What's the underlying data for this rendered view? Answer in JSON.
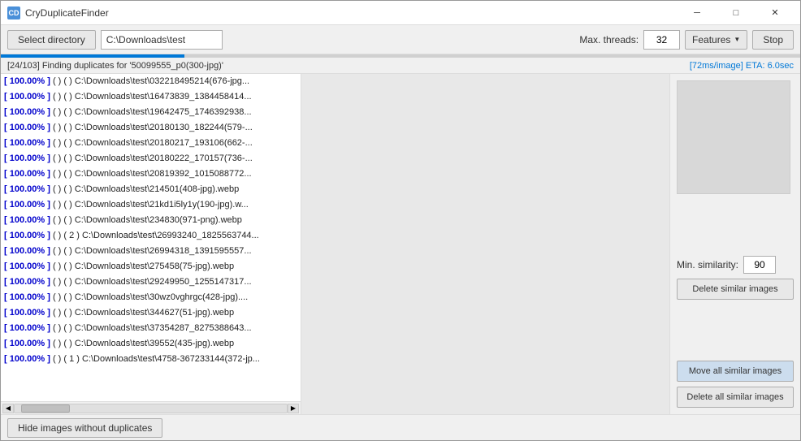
{
  "window": {
    "title": "CryDuplicateFinder",
    "icon": "CD"
  },
  "titleControls": {
    "minimize": "─",
    "maximize": "□",
    "close": "✕"
  },
  "toolbar": {
    "select_directory_label": "Select directory",
    "path_value": "C:\\Downloads\\test",
    "max_threads_label": "Max. threads:",
    "threads_value": "32",
    "features_label": "Features",
    "stop_label": "Stop"
  },
  "progress": {
    "fill_percent": 23,
    "status_text": "[24/103] Finding duplicates for '50099555_p0(300-jpg)'",
    "eta_text": "[72ms/image] ETA: 6.0sec"
  },
  "list": {
    "items": [
      {
        "pct": "[ 100.00% ]",
        "info": "( ) (  )",
        "path": "C:\\Downloads\\test\\032218495214(676-jpg..."
      },
      {
        "pct": "[ 100.00% ]",
        "info": "( ) (  )",
        "path": "C:\\Downloads\\test\\16473839_1384458414..."
      },
      {
        "pct": "[ 100.00% ]",
        "info": "( ) (  )",
        "path": "C:\\Downloads\\test\\19642475_1746392938..."
      },
      {
        "pct": "[ 100.00% ]",
        "info": "( ) (  )",
        "path": "C:\\Downloads\\test\\20180130_182244(579-..."
      },
      {
        "pct": "[ 100.00% ]",
        "info": "( ) (  )",
        "path": "C:\\Downloads\\test\\20180217_193106(662-..."
      },
      {
        "pct": "[ 100.00% ]",
        "info": "( ) (  )",
        "path": "C:\\Downloads\\test\\20180222_170157(736-..."
      },
      {
        "pct": "[ 100.00% ]",
        "info": "( ) (  )",
        "path": "C:\\Downloads\\test\\20819392_1015088772..."
      },
      {
        "pct": "[ 100.00% ]",
        "info": "( ) (  )",
        "path": "C:\\Downloads\\test\\214501(408-jpg).webp"
      },
      {
        "pct": "[ 100.00% ]",
        "info": "( ) (  )",
        "path": "C:\\Downloads\\test\\21kd1i5ly1y(190-jpg).w..."
      },
      {
        "pct": "[ 100.00% ]",
        "info": "( ) (  )",
        "path": "C:\\Downloads\\test\\234830(971-png).webp"
      },
      {
        "pct": "[ 100.00% ]",
        "info": "( ) ( 2 )",
        "path": "C:\\Downloads\\test\\26993240_1825563744..."
      },
      {
        "pct": "[ 100.00% ]",
        "info": "( ) (  )",
        "path": "C:\\Downloads\\test\\26994318_1391595557..."
      },
      {
        "pct": "[ 100.00% ]",
        "info": "( ) (  )",
        "path": "C:\\Downloads\\test\\275458(75-jpg).webp"
      },
      {
        "pct": "[ 100.00% ]",
        "info": "( ) (  )",
        "path": "C:\\Downloads\\test\\29249950_1255147317..."
      },
      {
        "pct": "[ 100.00% ]",
        "info": "( ) (  )",
        "path": "C:\\Downloads\\test\\30wz0vghrgc(428-jpg)...."
      },
      {
        "pct": "[ 100.00% ]",
        "info": "( ) (  )",
        "path": "C:\\Downloads\\test\\344627(51-jpg).webp"
      },
      {
        "pct": "[ 100.00% ]",
        "info": "( ) (  )",
        "path": "C:\\Downloads\\test\\37354287_8275388643..."
      },
      {
        "pct": "[ 100.00% ]",
        "info": "( ) (  )",
        "path": "C:\\Downloads\\test\\39552(435-jpg).webp"
      },
      {
        "pct": "[ 100.00% ]",
        "info": "( ) ( 1 )",
        "path": "C:\\Downloads\\test\\4758-367233144(372-jp..."
      }
    ]
  },
  "rightPanel": {
    "min_similarity_label": "Min. similarity:",
    "min_similarity_value": "90",
    "delete_similar_label": "Delete similar images",
    "move_all_label": "Move all similar images",
    "delete_all_label": "Delete all similar images"
  },
  "bottomBar": {
    "hide_btn_label": "Hide images without duplicates"
  }
}
